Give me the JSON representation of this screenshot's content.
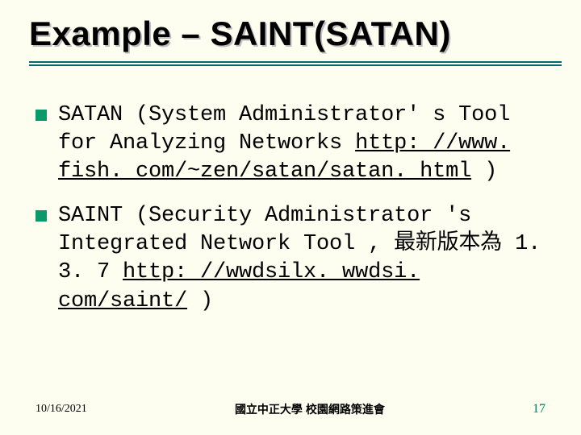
{
  "title": "Example – SAINT(SATAN)",
  "bullets": [
    {
      "pre": "SATAN (System Administrator' s Tool for Analyzing Networks ",
      "link": "http: //www. fish. com/~zen/satan/satan. html",
      "post": " )"
    },
    {
      "pre": "SAINT (Security Administrator 's Integrated Network Tool , 最新版本為 1. 3. 7 ",
      "link": "http: //wwdsilx. wwdsi. com/saint/",
      "post": " )"
    }
  ],
  "footer": {
    "date": "10/16/2021",
    "center": "國立中正大學 校園網路策進會",
    "pageNumber": "17"
  }
}
